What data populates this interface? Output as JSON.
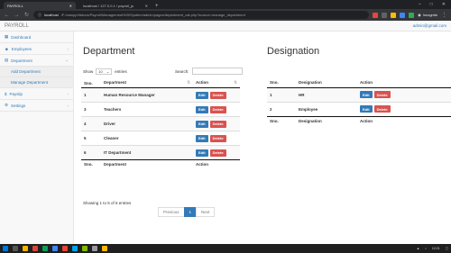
{
  "browser": {
    "tabs": [
      {
        "label": "PAYROLL",
        "active": true
      },
      {
        "label": "localhost / 127.0.0.1 / payroll_ju",
        "active": false
      }
    ],
    "url_host": "localhost",
    "url_path": "/F:/xampp/htdocs/Payroll/Management%20System/admin/pages/department_cat.php?source=manage_department",
    "profile_label": "Incognito"
  },
  "app": {
    "brand": "PAYROLL",
    "user": "admin@gmail.com"
  },
  "sidebar": {
    "items": [
      {
        "label": "Dashboard",
        "icon": "dashboard-icon"
      },
      {
        "label": "Employees",
        "icon": "users-icon"
      },
      {
        "label": "Department",
        "icon": "building-icon"
      }
    ],
    "sub_items": [
      "Add Department",
      "Manage Department"
    ],
    "items_after": [
      {
        "label": "Payslip",
        "icon": "payslip-icon"
      },
      {
        "label": "Settings",
        "icon": "gear-icon"
      }
    ]
  },
  "department": {
    "title": "Department",
    "show_label": "Show",
    "entries_value": "10",
    "entries_label": "entries",
    "search_label": "Search:",
    "columns": [
      "Sno.",
      "Department",
      "Action"
    ],
    "rows": [
      {
        "sno": "1",
        "name": "Human Resource Manager"
      },
      {
        "sno": "3",
        "name": "Teachers"
      },
      {
        "sno": "4",
        "name": "Driver"
      },
      {
        "sno": "5",
        "name": "Cleaner"
      },
      {
        "sno": "6",
        "name": "IT Department"
      }
    ],
    "info": "Showing 1 to 5 of 5 entries",
    "pager": {
      "previous": "Previous",
      "page": "1",
      "next": "Next"
    }
  },
  "designation": {
    "title": "Designation",
    "columns": [
      "Sno.",
      "Designation",
      "Action"
    ],
    "rows": [
      {
        "sno": "1",
        "name": "HR"
      },
      {
        "sno": "2",
        "name": "Employee"
      }
    ]
  },
  "actions": {
    "edit": "Edit",
    "delete": "Delete"
  },
  "taskbar": {
    "time": "12:21"
  },
  "colors": {
    "primary": "#337ab7",
    "danger": "#d9534f"
  }
}
